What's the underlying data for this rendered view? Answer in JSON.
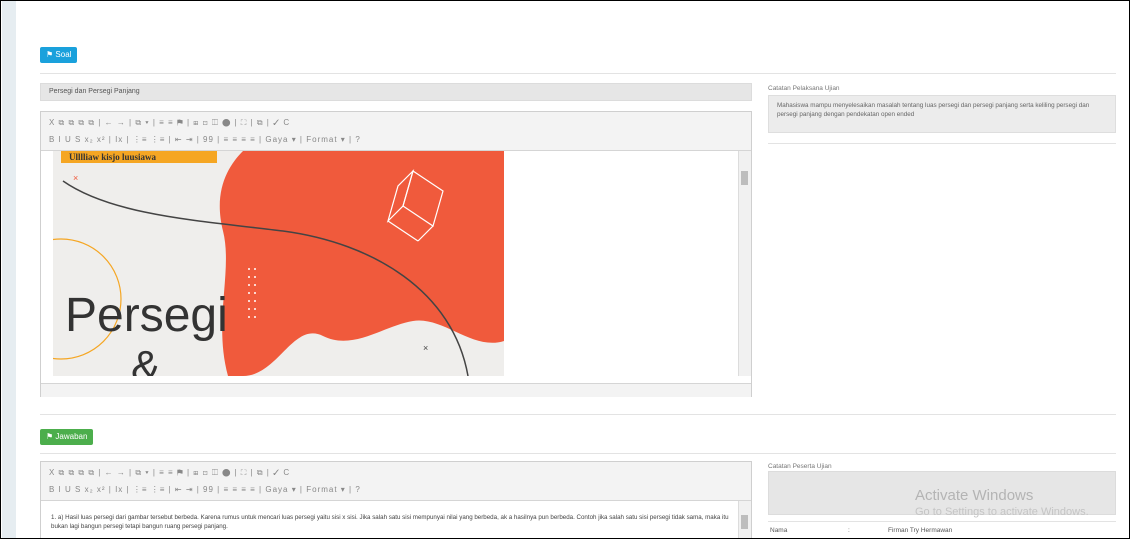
{
  "soal_button": "Soal",
  "jawaban_button": "Jawaban",
  "question_title": "Persegi dan Persegi Panjang",
  "toolbar": {
    "row1": "X  ⧉  ⧉  ⧉  ⧉ |  ←  →  |  ⧉  ▾  |  ≡  ≡  ⚑  |  ⊞  ⊡  ◫  ⬤  |  ⛶  |  ⧉  |  ✓  C",
    "row2": "B  I  U  S  x₂  x²  |  Ix  |  ⋮≡  ⋮≡  |  ⇤  ⇥  |  99  |  ≡  ≡  ≡  ≡  |  Gaya    ▾  |  Format    ▾  |  ?"
  },
  "catatan_pelaksana_label": "Catatan Pelaksana Ujian",
  "catatan_pelaksana_text": "Mahasiswa mampu menyelesaikan masalah tentang luas persegi dan persegi panjang serta keliling persegi dan persegi panjang dengan pendekatan open ended",
  "image": {
    "banner": "Ulllliaw kisjo l\u0005uusiawa",
    "title_line1": "Persegi",
    "title_line2": "&",
    "accent_color": "#f05a3c",
    "banner_color": "#f5a623"
  },
  "answer_text": "1. a) Hasil luas persegi dari gambar tersebut berbeda. Karena rumus untuk mencari luas persegi yaitu sisi x sisi. Jika salah satu sisi mempunyai nilai yang berbeda, ak a hasilnya pun berbeda. Contoh jika salah satu sisi persegi tidak sama, maka itu bukan lagi bangun persegi tetapi bangun ruang persegi panjang.",
  "catatan_peserta_label": "Catatan Peserta Ujian",
  "activate_title": "Activate Windows",
  "activate_sub": "Go to Settings to activate Windows.",
  "table": {
    "nama_label": "Nama",
    "sep": ":",
    "nama_value": "Firman Try Hermawan"
  }
}
